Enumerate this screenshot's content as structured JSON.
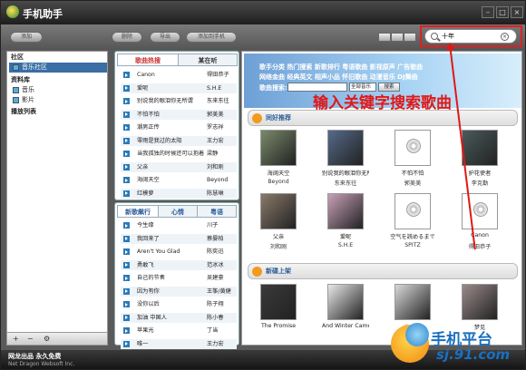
{
  "app": {
    "title": "手机助手",
    "min": "–",
    "max": "□",
    "close": "×"
  },
  "toolbar": {
    "btn1": "添加",
    "btn2": "删除",
    "btn3": "导出",
    "btn4": "添加到手机"
  },
  "search": {
    "value": "十年"
  },
  "sidebar": {
    "sections": [
      "社区",
      "资料库",
      "播放列表"
    ],
    "items": [
      {
        "label": "音乐社区",
        "selected": true
      },
      {
        "label": "音乐"
      },
      {
        "label": "影片"
      }
    ],
    "footer": [
      "+",
      "−",
      "⚙"
    ]
  },
  "hot": {
    "tabs": [
      "歌曲热搜",
      "某在听"
    ],
    "rows": [
      {
        "song": "Canon",
        "artist": "得田恭子"
      },
      {
        "song": "爱呢",
        "artist": "S.H.E"
      },
      {
        "song": "别说我的眼泪你无所谓",
        "artist": "东来东往"
      },
      {
        "song": "不怕不怕",
        "artist": "郭美美"
      },
      {
        "song": "潮男正传",
        "artist": "罗志祥"
      },
      {
        "song": "零雨是我过的太阳",
        "artist": "王力宏"
      },
      {
        "song": "当我孤独的时候还可以抱着你",
        "artist": "梁静"
      },
      {
        "song": "父亲",
        "artist": "刘和刚"
      },
      {
        "song": "海阔天空",
        "artist": "Beyond"
      },
      {
        "song": "红模萝",
        "artist": "陈慧琳"
      }
    ]
  },
  "newsongs": {
    "tabs": [
      "新歌飙行",
      "心情",
      "粤语"
    ],
    "rows": [
      {
        "song": "今生缘",
        "artist": "川子"
      },
      {
        "song": "我回来了",
        "artist": "蔡晏柏"
      },
      {
        "song": "Aren't You Glad",
        "artist": "陈奕迅"
      },
      {
        "song": "勇敢飞",
        "artist": "范冰冰"
      },
      {
        "song": "自己的节奏",
        "artist": "吴建豪"
      },
      {
        "song": "因为有你",
        "artist": "王筝/黄健"
      },
      {
        "song": "没你以后",
        "artist": "陈子翔"
      },
      {
        "song": "加油 中国人",
        "artist": "陈小春"
      },
      {
        "song": "苹果光",
        "artist": "丁当"
      },
      {
        "song": "唯一",
        "artist": "王力宏"
      }
    ]
  },
  "banner": {
    "nav1": "歌手分类 热门搜索 新歌排行 粤语歌曲 影视原声 广告歌曲",
    "nav2": "网络金曲 经典英文 相声小品 怀旧歌曲 动漫音乐 DJ舞曲",
    "search_label": "歌曲搜索:",
    "select": "全部音乐",
    "button": "搜索"
  },
  "annotation": "输入关键字搜索歌曲",
  "sections": {
    "recommend": "同好推荐",
    "new": "新碟上架"
  },
  "recommend": [
    {
      "title": "海阔天空",
      "artist": "Beyond",
      "color": "#7a8a6a"
    },
    {
      "title": "别说我的眼泪你无所谓",
      "artist": "东来东往",
      "color": "#556a8a"
    },
    {
      "title": "不怕不怕",
      "artist": "郭美美",
      "color": "disc"
    },
    {
      "title": "护花使者",
      "artist": "李克勤",
      "color": "#4a5a5a"
    },
    {
      "title": "父亲",
      "artist": "刘和刚",
      "color": "#8a7a6a"
    },
    {
      "title": "爱呢",
      "artist": "S.H.E",
      "color": "#c8a0b8"
    },
    {
      "title": "空气を読めるまで",
      "artist": "SPITZ",
      "color": "disc"
    },
    {
      "title": "Canon",
      "artist": "得田恭子",
      "color": "disc"
    }
  ],
  "newalbums": [
    {
      "title": "The Promise",
      "color": "#3a3a3a"
    },
    {
      "title": "And Winter Came",
      "color": "#e8e8e8"
    },
    {
      "title": "丰の乐",
      "color": "#d8d8d8"
    },
    {
      "title": "梦见",
      "color": "#9a8a8a"
    }
  ],
  "status": {
    "line1": "网龙出品 永久免费",
    "line2": "Net Dragon Websoft Inc."
  },
  "watermark": {
    "line1": "手机平台",
    "line2": "sj.91.com"
  }
}
